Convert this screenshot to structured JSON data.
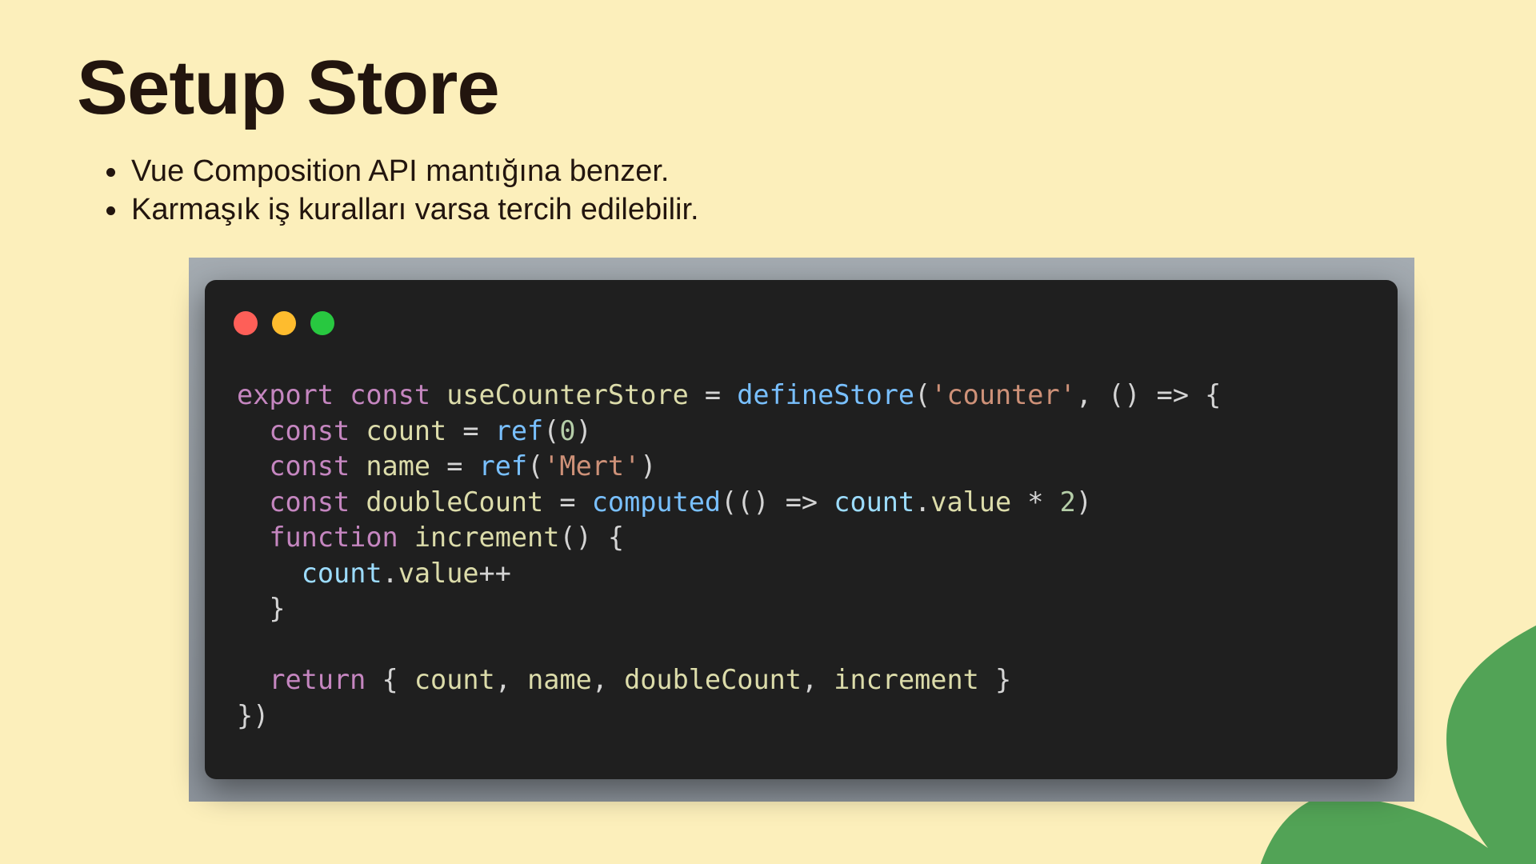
{
  "slide": {
    "title": "Setup Store",
    "bullets": [
      "Vue Composition API mantığına benzer.",
      "Karmaşık iş kuralları varsa tercih edilebilir."
    ]
  },
  "code_window": {
    "language": "javascript",
    "lines": [
      [
        {
          "t": "export",
          "c": "kw"
        },
        {
          "t": " ",
          "c": "punc"
        },
        {
          "t": "const",
          "c": "kw"
        },
        {
          "t": " ",
          "c": "punc"
        },
        {
          "t": "useCounterStore",
          "c": "fn"
        },
        {
          "t": " = ",
          "c": "punc"
        },
        {
          "t": "defineStore",
          "c": "call"
        },
        {
          "t": "(",
          "c": "punc"
        },
        {
          "t": "'counter'",
          "c": "str"
        },
        {
          "t": ", () => {",
          "c": "punc"
        }
      ],
      [
        {
          "t": "  ",
          "c": "punc"
        },
        {
          "t": "const",
          "c": "kw"
        },
        {
          "t": " ",
          "c": "punc"
        },
        {
          "t": "count",
          "c": "fn"
        },
        {
          "t": " = ",
          "c": "punc"
        },
        {
          "t": "ref",
          "c": "call"
        },
        {
          "t": "(",
          "c": "punc"
        },
        {
          "t": "0",
          "c": "num"
        },
        {
          "t": ")",
          "c": "punc"
        }
      ],
      [
        {
          "t": "  ",
          "c": "punc"
        },
        {
          "t": "const",
          "c": "kw"
        },
        {
          "t": " ",
          "c": "punc"
        },
        {
          "t": "name",
          "c": "fn"
        },
        {
          "t": " = ",
          "c": "punc"
        },
        {
          "t": "ref",
          "c": "call"
        },
        {
          "t": "(",
          "c": "punc"
        },
        {
          "t": "'Mert'",
          "c": "str"
        },
        {
          "t": ")",
          "c": "punc"
        }
      ],
      [
        {
          "t": "  ",
          "c": "punc"
        },
        {
          "t": "const",
          "c": "kw"
        },
        {
          "t": " ",
          "c": "punc"
        },
        {
          "t": "doubleCount",
          "c": "fn"
        },
        {
          "t": " = ",
          "c": "punc"
        },
        {
          "t": "computed",
          "c": "call"
        },
        {
          "t": "(() => ",
          "c": "punc"
        },
        {
          "t": "count",
          "c": "var"
        },
        {
          "t": ".",
          "c": "punc"
        },
        {
          "t": "value",
          "c": "fn"
        },
        {
          "t": " * ",
          "c": "punc"
        },
        {
          "t": "2",
          "c": "num"
        },
        {
          "t": ")",
          "c": "punc"
        }
      ],
      [
        {
          "t": "  ",
          "c": "punc"
        },
        {
          "t": "function",
          "c": "kw"
        },
        {
          "t": " ",
          "c": "punc"
        },
        {
          "t": "increment",
          "c": "fn"
        },
        {
          "t": "() {",
          "c": "punc"
        }
      ],
      [
        {
          "t": "    ",
          "c": "punc"
        },
        {
          "t": "count",
          "c": "var"
        },
        {
          "t": ".",
          "c": "punc"
        },
        {
          "t": "value",
          "c": "fn"
        },
        {
          "t": "++",
          "c": "punc"
        }
      ],
      [
        {
          "t": "  }",
          "c": "punc"
        }
      ],
      [
        {
          "t": "",
          "c": "punc"
        }
      ],
      [
        {
          "t": "  ",
          "c": "punc"
        },
        {
          "t": "return",
          "c": "kw"
        },
        {
          "t": " { ",
          "c": "punc"
        },
        {
          "t": "count",
          "c": "fn"
        },
        {
          "t": ", ",
          "c": "punc"
        },
        {
          "t": "name",
          "c": "fn"
        },
        {
          "t": ", ",
          "c": "punc"
        },
        {
          "t": "doubleCount",
          "c": "fn"
        },
        {
          "t": ", ",
          "c": "punc"
        },
        {
          "t": "increment",
          "c": "fn"
        },
        {
          "t": " }",
          "c": "punc"
        }
      ],
      [
        {
          "t": "})",
          "c": "punc"
        }
      ]
    ]
  },
  "colors": {
    "background": "#fcefbb",
    "accent_blob": "#52a356",
    "text": "#22150e",
    "code_bg": "#1f1f1f",
    "window_red": "#fe5f58",
    "window_yellow": "#febc2e",
    "window_green": "#28c840"
  }
}
